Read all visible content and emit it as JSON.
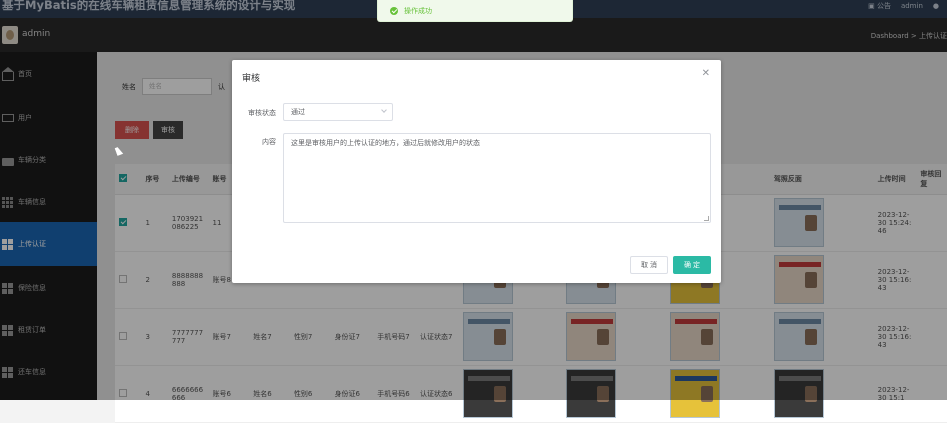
{
  "app": {
    "title": "基于MyBatis的在线车辆租赁信息管理系统的设计与实现",
    "notice": "公告",
    "user": "admin"
  },
  "userbar": {
    "name": "admin",
    "breadcrumb": "Dashboard > 上传认证"
  },
  "sidebar": {
    "items": [
      {
        "label": "首页",
        "icon": "home-icon"
      },
      {
        "label": "用户",
        "icon": "monitor-icon"
      },
      {
        "label": "车辆分类",
        "icon": "bag-icon"
      },
      {
        "label": "车辆信息",
        "icon": "grid-icon"
      },
      {
        "label": "上传认证",
        "icon": "grid-icon",
        "active": true
      },
      {
        "label": "保险信息",
        "icon": "grid-icon"
      },
      {
        "label": "租赁订单",
        "icon": "grid-icon"
      },
      {
        "label": "还车信息",
        "icon": "grid-icon"
      }
    ]
  },
  "search": {
    "label_name": "姓名",
    "placeholder_name": "姓名",
    "label_auth": "认"
  },
  "buttons": {
    "delete": "删除",
    "audit": "审核"
  },
  "table": {
    "headers": {
      "index": "序号",
      "upload_no": "上传编号",
      "account": "账号",
      "license_back": "驾照反面",
      "upload_time": "上传时间",
      "audit_reply": "审核回复"
    },
    "rows": [
      {
        "checked": true,
        "index": "1",
        "upload_no": "1703921086225",
        "account": "11",
        "name": "",
        "gender": "",
        "idcard": "",
        "phone": "",
        "auth": "",
        "upload_time": "2023-12-30 15:24:46"
      },
      {
        "checked": false,
        "index": "2",
        "upload_no": "8888888888",
        "account": "账号8",
        "name": "",
        "gender": "",
        "idcard": "",
        "phone": "8",
        "auth": "8",
        "upload_time": "2023-12-30 15:16:43"
      },
      {
        "checked": false,
        "index": "3",
        "upload_no": "7777777777",
        "account": "账号7",
        "name": "姓名7",
        "gender": "性别7",
        "idcard": "身份证7",
        "phone": "手机号码7",
        "auth": "认证状态7",
        "upload_time": "2023-12-30 15:16:43"
      },
      {
        "checked": false,
        "index": "4",
        "upload_no": "6666666666",
        "account": "账号6",
        "name": "姓名6",
        "gender": "性别6",
        "idcard": "身份证6",
        "phone": "手机号码6",
        "auth": "认证状态6",
        "upload_time": "2023-12-30 15:1"
      }
    ]
  },
  "toast": {
    "text": "操作成功"
  },
  "dialog": {
    "title": "审核",
    "status_label": "审核状态",
    "status_value": "通过",
    "content_label": "内容",
    "content_value": "这里是审核用户的上传认证的地方，通过后就修改用户的状态",
    "cancel": "取 消",
    "confirm": "确 定"
  }
}
